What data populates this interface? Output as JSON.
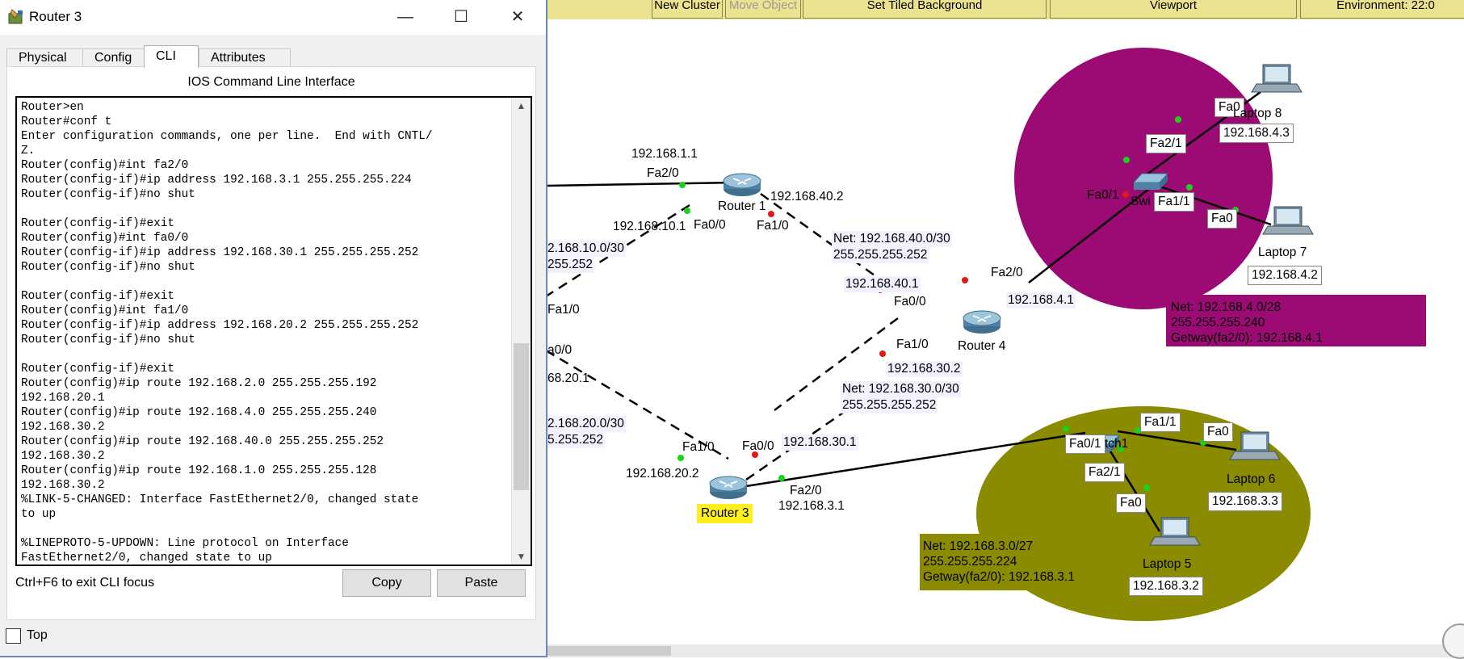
{
  "window": {
    "title": "Router 3",
    "minimize": "—",
    "maximize": "☐",
    "close": "✕"
  },
  "tabs": [
    {
      "label": "Physical",
      "active": false
    },
    {
      "label": "Config",
      "active": false
    },
    {
      "label": "CLI",
      "active": true
    },
    {
      "label": "Attributes",
      "active": false
    }
  ],
  "cli": {
    "heading": "IOS Command Line Interface",
    "lines": [
      "Router>en",
      "Router#conf t",
      "Enter configuration commands, one per line.  End with CNTL/",
      "Z.",
      "Router(config)#int fa2/0",
      "Router(config-if)#ip address 192.168.3.1 255.255.255.224",
      "Router(config-if)#no shut",
      "",
      "Router(config-if)#exit",
      "Router(config)#int fa0/0",
      "Router(config-if)#ip address 192.168.30.1 255.255.255.252",
      "Router(config-if)#no shut",
      "",
      "Router(config-if)#exit",
      "Router(config)#int fa1/0",
      "Router(config-if)#ip address 192.168.20.2 255.255.255.252",
      "Router(config-if)#no shut",
      "",
      "Router(config-if)#exit",
      "Router(config)#ip route 192.168.2.0 255.255.255.192",
      "192.168.20.1",
      "Router(config)#ip route 192.168.4.0 255.255.255.240",
      "192.168.30.2",
      "Router(config)#ip route 192.168.40.0 255.255.255.252",
      "192.168.30.2",
      "Router(config)#ip route 192.168.1.0 255.255.255.128",
      "192.168.30.2",
      "%LINK-5-CHANGED: Interface FastEthernet2/0, changed state",
      "to up",
      "",
      "%LINEPROTO-5-UPDOWN: Line protocol on Interface",
      "FastEthernet2/0, changed state to up"
    ],
    "hint": "Ctrl+F6 to exit CLI focus",
    "copy_label": "Copy",
    "paste_label": "Paste"
  },
  "top_checkbox": {
    "label": "Top",
    "checked": false
  },
  "toolbar": {
    "new_cluster": "New Cluster",
    "move_object": "Move Object",
    "set_tiled_background": "Set Tiled Background",
    "viewport": "Viewport",
    "environment": "Environment: 22:0"
  },
  "topology": {
    "colors": {
      "lan4": "#9c0a73",
      "lan3": "#8b8b00",
      "selected": "#ffef1f"
    },
    "labels": {
      "r1_fa20_ip": "192.168.1.1",
      "r1_fa20": "Fa2/0",
      "router1": "Router 1",
      "r1_fa00_ip": "192.168.10.1",
      "r1_fa00": "Fa0/0",
      "r1_fa10": "Fa1/0",
      "r1_fa10_ip": "192.168.40.2",
      "net10_a": "2.168.10.0/30",
      "net10_b": "255.252",
      "net40_a": "Net: 192.168.40.0/30",
      "net40_b": "255.255.255.252",
      "r2_fa10": "Fa1/0",
      "r2_fa00": "a0/0",
      "r2_ip20": "68.20.1",
      "net20_a": "2.168.20.0/30",
      "net20_b": "5.255.252",
      "r4_fa00_ip": "192.168.40.1",
      "r4_fa00": "Fa0/0",
      "r4_fa20": "Fa2/0",
      "r4_fa20_ip": "192.168.4.1",
      "router4": "Router 4",
      "r4_fa10": "Fa1/0",
      "r4_fa10_ip": "192.168.30.2",
      "net30_a": "Net: 192.168.30.0/30",
      "net30_b": "255.255.255.252",
      "r3_fa10": "Fa1/0",
      "r3_fa10_ip": "192.168.20.2",
      "r3_fa00": "Fa0/0",
      "r3_fa00_ip": "192.168.30.1",
      "router3": "Router 3",
      "r3_fa20": "Fa2/0",
      "r3_fa20_ip": "192.168.3.1",
      "sw_top_fa01": "Fa0/1",
      "sw_top_name": "Swi",
      "sw_top_fa21": "Fa2/1",
      "sw_top_fa11": "Fa1/1",
      "laptop8_fa0": "Fa0",
      "laptop8": "Laptop 8",
      "laptop8_ip": "192.168.4.3",
      "laptop7_fa0": "Fa0",
      "laptop7": "Laptop 7",
      "laptop7_ip": "192.168.4.2",
      "net4_a": "Net: 192.168.4.0/28",
      "net4_b": "255.255.255.240",
      "net4_c": "Getway(fa2/0): 192.168.4.1",
      "sw_bot_fa01": "Fa0/1",
      "sw_bot_name": "tch1",
      "sw_bot_fa11": "Fa1/1",
      "sw_bot_fa21": "Fa2/1",
      "laptop6_fa0": "Fa0",
      "laptop6": "Laptop 6",
      "laptop6_ip": "192.168.3.3",
      "laptop5_fa0": "Fa0",
      "laptop5": "Laptop 5",
      "laptop5_ip": "192.168.3.2",
      "net3_a": "Net: 192.168.3.0/27",
      "net3_b": "255.255.255.224",
      "net3_c": "Getway(fa2/0): 192.168.3.1"
    }
  }
}
